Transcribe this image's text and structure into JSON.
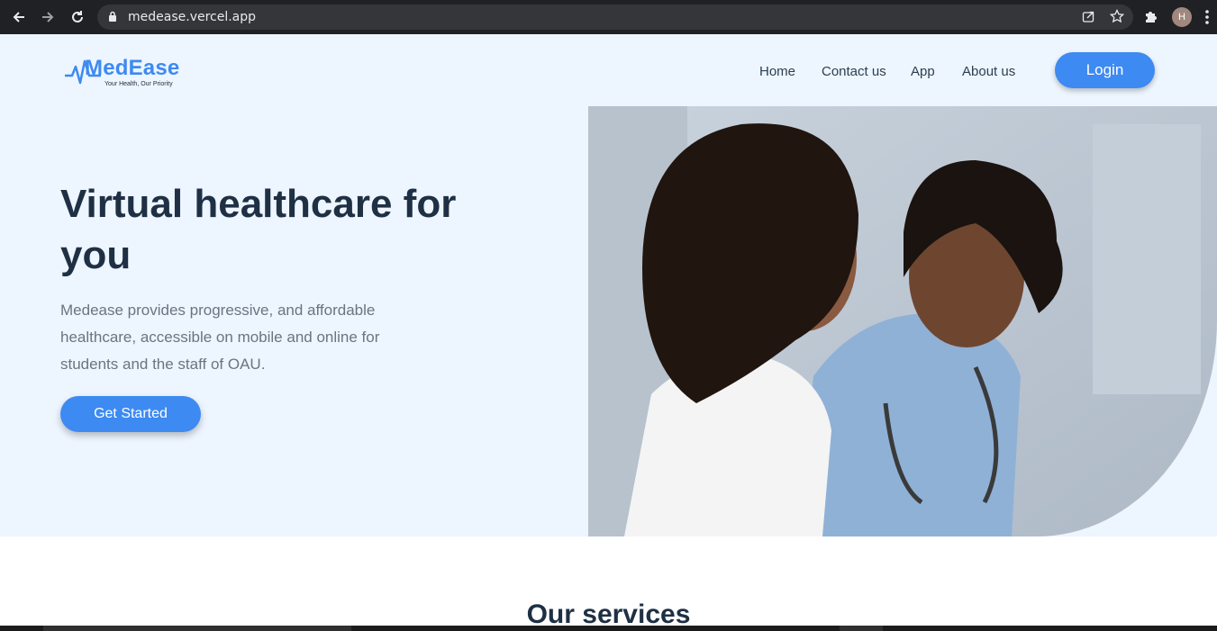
{
  "browser": {
    "url": "medease.vercel.app",
    "profile_initial": "H",
    "icons": [
      "back-arrow-icon",
      "forward-arrow-icon",
      "reload-icon",
      "lock-icon",
      "share-icon",
      "star-icon",
      "extensions-icon",
      "more-vert-icon"
    ]
  },
  "header": {
    "logo_text": "MedEase",
    "logo_tagline": "Your Health, Our Priority",
    "nav": [
      "Home",
      "Contact us",
      "App",
      "About us"
    ],
    "login_label": "Login"
  },
  "hero": {
    "title": "Virtual healthcare for you",
    "description": "Medease provides progressive, and affordable healthcare, accessible on mobile and online for students and the staff of OAU.",
    "cta_label": "Get Started",
    "image": "photo-of-patient-and-doctor-with-stethoscope"
  },
  "services": {
    "title": "Our services"
  },
  "colors": {
    "accent": "#3d8af2",
    "hero_bg": "#edf5ff",
    "heading": "#1f3044",
    "body_text": "#6b7480",
    "chrome": "#202124"
  }
}
